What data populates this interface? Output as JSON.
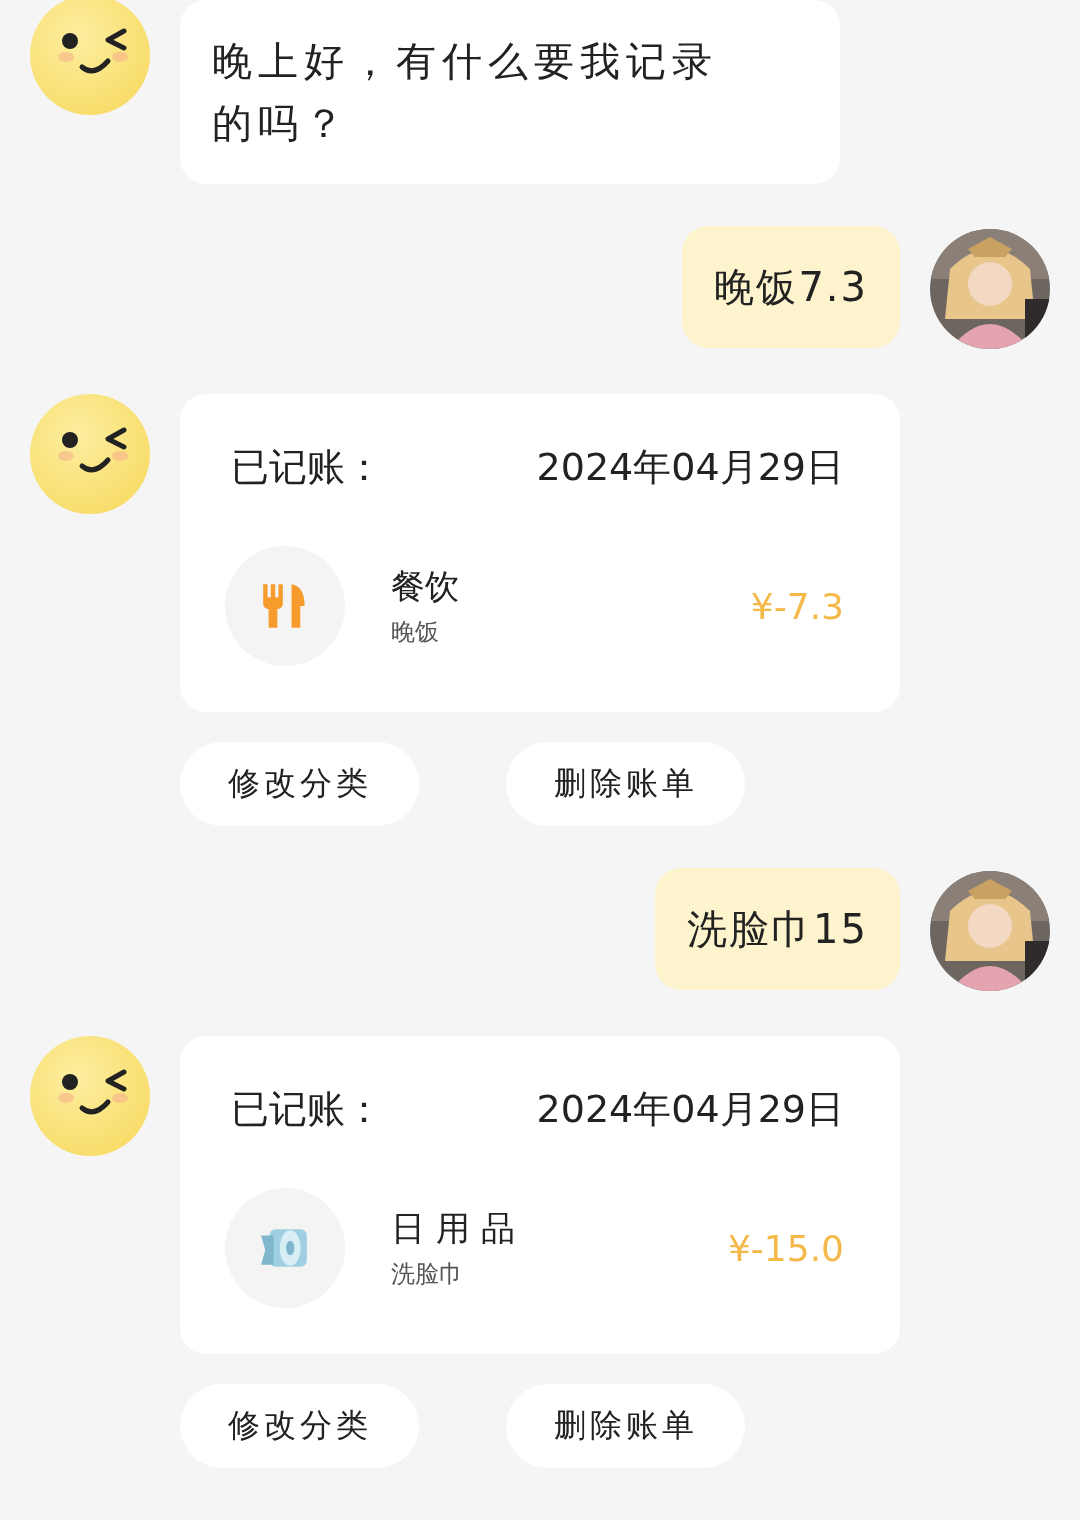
{
  "messages": [
    {
      "kind": "bot_text",
      "text": "晚上好，有什么要我记录的吗？"
    },
    {
      "kind": "user_text",
      "text": "晚饭7.3"
    },
    {
      "kind": "bot_record",
      "label": "已记账：",
      "date": "2024年04月29日",
      "category": "餐饮",
      "note": "晚饭",
      "amount": "¥-7.3",
      "actions": [
        "修改分类",
        "删除账单"
      ]
    },
    {
      "kind": "user_text",
      "text": "洗脸巾15"
    },
    {
      "kind": "bot_record",
      "label": "已记账：",
      "date": "2024年04月29日",
      "category": "日 用 品",
      "note": "洗脸巾",
      "amount": "¥-15.0",
      "actions": [
        "修改分类",
        "删除账单"
      ]
    }
  ]
}
